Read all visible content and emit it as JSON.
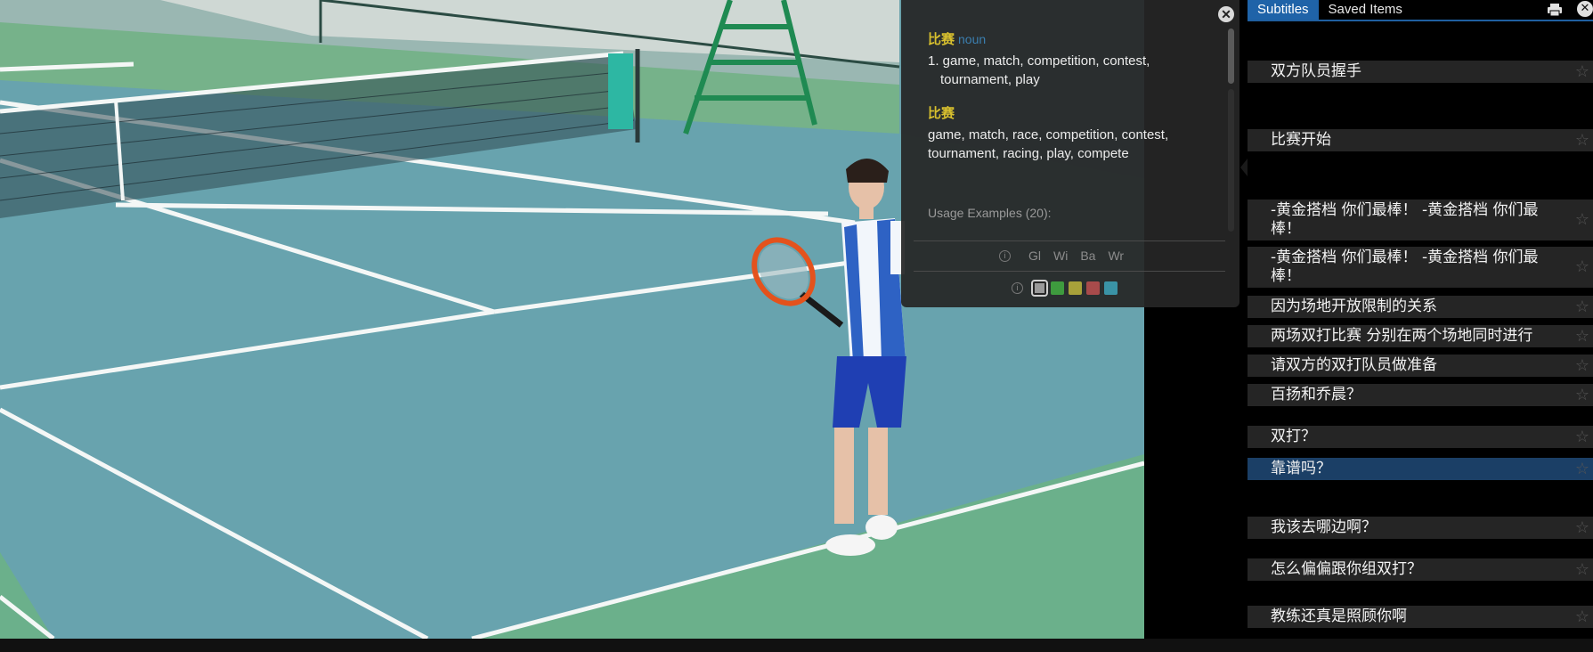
{
  "dictionary": {
    "close_icon": "close-icon",
    "entries": [
      {
        "headword": "比赛",
        "pos": "noun",
        "definition": "1. game, match, competition, contest, tournament, play"
      },
      {
        "headword": "比赛",
        "pos": "",
        "definition": "game, match, race, competition, contest, tournament, racing, play, compete"
      }
    ],
    "usage_examples": "Usage Examples (20):",
    "source_tabs": [
      "Gl",
      "Wi",
      "Ba",
      "Wr"
    ],
    "highlight_colors": [
      "#9a9a9a",
      "#3e9b3e",
      "#a8a13a",
      "#a84b4b",
      "#3a93a6"
    ]
  },
  "panel": {
    "tabs": [
      {
        "label": "Subtitles",
        "active": true
      },
      {
        "label": "Saved Items",
        "active": false
      }
    ],
    "print_icon": "print-icon",
    "close_icon": "close-icon",
    "subtitles": [
      {
        "text": "双方队员握手"
      },
      {
        "text": "比赛开始"
      },
      {
        "text": "-黄金搭档 你们最棒！ -黄金搭档 你们最棒！"
      },
      {
        "text": "-黄金搭档 你们最棒！ -黄金搭档 你们最棒！"
      },
      {
        "text": "因为场地开放限制的关系"
      },
      {
        "text": "两场双打比赛 分别在两个场地同时进行"
      },
      {
        "text": "请双方的双打队员做准备"
      },
      {
        "text": "百扬和乔晨？"
      },
      {
        "text": "双打？"
      },
      {
        "text": "靠谱吗？",
        "active": true
      },
      {
        "text": "我该去哪边啊？"
      },
      {
        "text": "怎么偏偏跟你组双打？"
      },
      {
        "text": "教练还真是照顾你啊"
      }
    ]
  }
}
